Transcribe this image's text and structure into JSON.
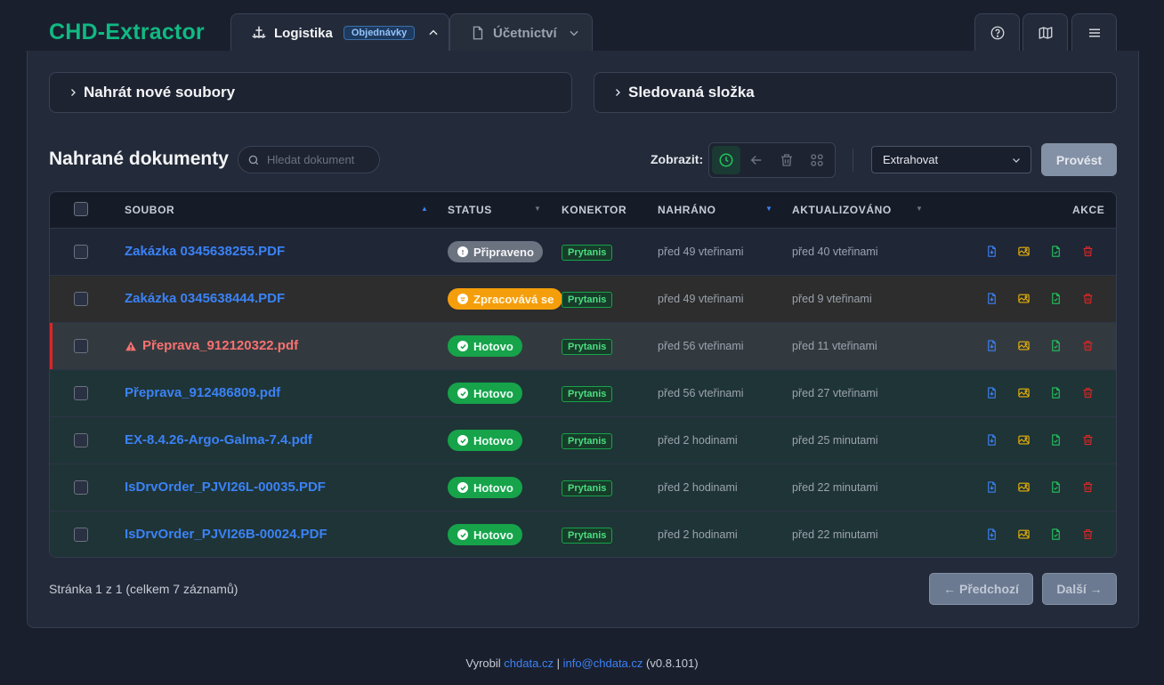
{
  "header": {
    "brand": "CHD-Extractor",
    "tabs": [
      {
        "label": "Logistika",
        "badge": "Objednávky",
        "active": true,
        "icon": "ship-icon"
      },
      {
        "label": "Účetnictví",
        "active": false,
        "icon": "document-icon"
      }
    ],
    "buttons": [
      "help-icon",
      "map-icon",
      "menu-icon"
    ]
  },
  "panels": {
    "upload": "Nahrát nové soubory",
    "watched": "Sledovaná složka"
  },
  "documents": {
    "title": "Nahrané dokumenty",
    "search_placeholder": "Hledat dokument",
    "view_label": "Zobrazit:",
    "action_select": "Extrahovat",
    "run_button": "Provést"
  },
  "table": {
    "columns": {
      "file": "SOUBOR",
      "status": "STATUS",
      "connector": "KONEKTOR",
      "uploaded": "NAHRÁNO",
      "updated": "AKTUALIZOVÁNO",
      "actions": "AKCE"
    },
    "rows": [
      {
        "file": "Zakázka 0345638255.PDF",
        "status": "Připraveno",
        "connector": "Prytanis",
        "uploaded": "před 49 vteřinami",
        "updated": "před 40 vteřinami"
      },
      {
        "file": "Zakázka 0345638444.PDF",
        "status": "Zpracovává se",
        "connector": "Prytanis",
        "uploaded": "před 49 vteřinami",
        "updated": "před 9 vteřinami"
      },
      {
        "file": "Přeprava_912120322.pdf",
        "status": "Hotovo",
        "connector": "Prytanis",
        "uploaded": "před 56 vteřinami",
        "updated": "před 11 vteřinami"
      },
      {
        "file": "Přeprava_912486809.pdf",
        "status": "Hotovo",
        "connector": "Prytanis",
        "uploaded": "před 56 vteřinami",
        "updated": "před 27 vteřinami"
      },
      {
        "file": "EX-8.4.26-Argo-Galma-7.4.pdf",
        "status": "Hotovo",
        "connector": "Prytanis",
        "uploaded": "před 2 hodinami",
        "updated": "před 25 minutami"
      },
      {
        "file": "IsDrvOrder_PJVI26L-00035.PDF",
        "status": "Hotovo",
        "connector": "Prytanis",
        "uploaded": "před 2 hodinami",
        "updated": "před 22 minutami"
      },
      {
        "file": "IsDrvOrder_PJVI26B-00024.PDF",
        "status": "Hotovo",
        "connector": "Prytanis",
        "uploaded": "před 2 hodinami",
        "updated": "před 22 minutami"
      }
    ]
  },
  "pagination": {
    "info": "Stránka 1 z 1 (celkem 7 záznamů)",
    "prev": "← Předchozí",
    "next": "Další →"
  },
  "footer": {
    "made_by": "Vyrobil",
    "site": "chdata.cz",
    "separator": "|",
    "email": "info@chdata.cz",
    "version": "(v0.8.101)"
  },
  "colors": {
    "brand": "#10b981",
    "link": "#3b82f6",
    "ready": "#6b7280",
    "processing": "#f59e0b",
    "done": "#16a34a",
    "error": "#f87171"
  }
}
